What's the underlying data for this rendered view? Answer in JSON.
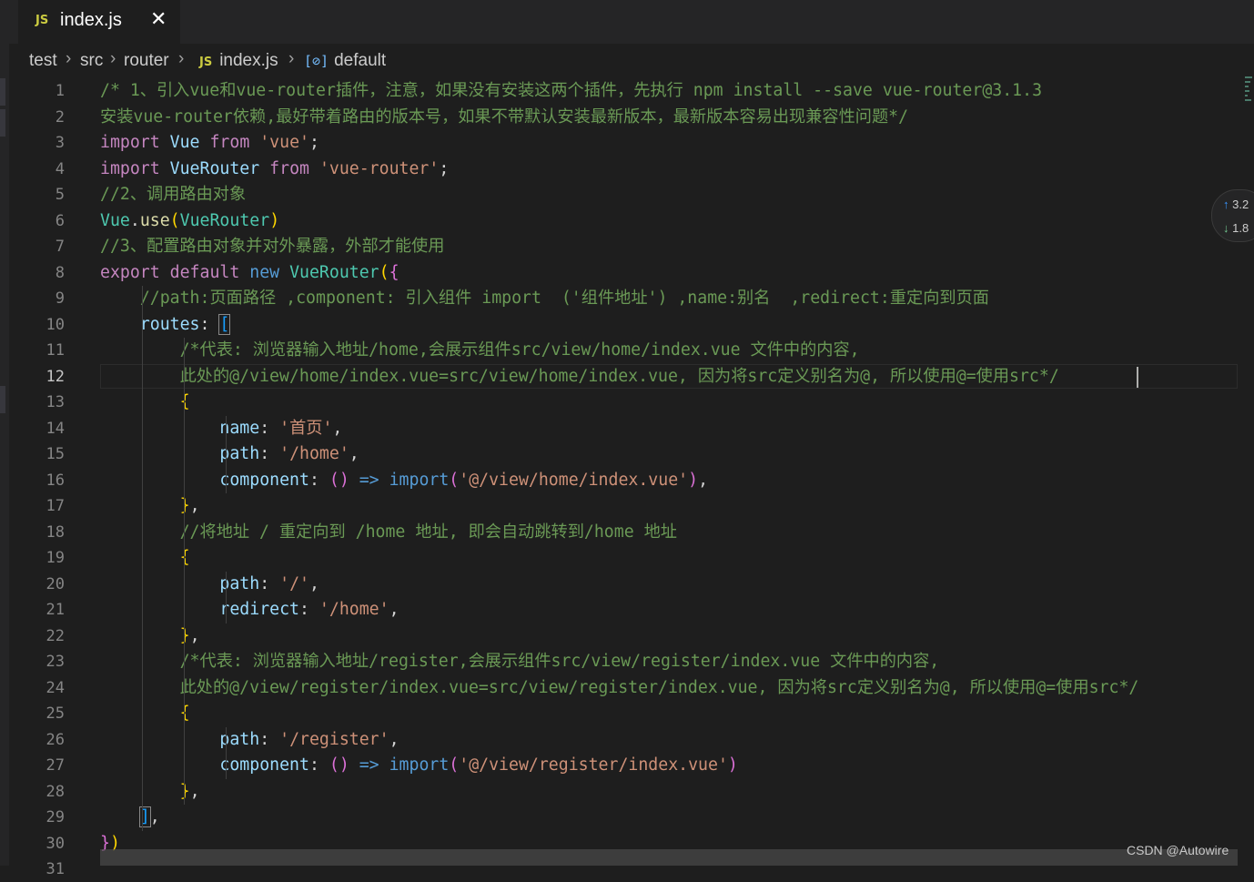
{
  "tab": {
    "icon": "JS",
    "title": "index.js",
    "close": "✕"
  },
  "breadcrumb": {
    "items": [
      "test",
      "src",
      "router",
      "index.js",
      "default"
    ],
    "separator": "›",
    "file_icon": "JS",
    "symbol_icon": "[⊘]"
  },
  "editor": {
    "active_line": 12,
    "lines": [
      {
        "n": "1",
        "code": "/* 1、引入vue和vue-router插件，注意，如果没有安装这两个插件，先执行 npm install --save vue-router@3.1.3"
      },
      {
        "n": "2",
        "code": "安装vue-router依赖,最好带着路由的版本号，如果不带默认安装最新版本，最新版本容易出现兼容性问题*/"
      },
      {
        "n": "3",
        "code": "import Vue from 'vue';"
      },
      {
        "n": "4",
        "code": "import VueRouter from 'vue-router';"
      },
      {
        "n": "5",
        "code": "//2、调用路由对象"
      },
      {
        "n": "6",
        "code": "Vue.use(VueRouter)"
      },
      {
        "n": "7",
        "code": "//3、配置路由对象并对外暴露，外部才能使用"
      },
      {
        "n": "8",
        "code": "export default new VueRouter({"
      },
      {
        "n": "9",
        "code": "    //path:页面路径 ,component: 引入组件 import  ('组件地址') ,name:别名  ,redirect:重定向到页面"
      },
      {
        "n": "10",
        "code": "    routes: ["
      },
      {
        "n": "11",
        "code": "        /*代表: 浏览器输入地址/home,会展示组件src/view/home/index.vue 文件中的内容,"
      },
      {
        "n": "12",
        "code": "        此处的@/view/home/index.vue=src/view/home/index.vue, 因为将src定义别名为@, 所以使用@=使用src*/"
      },
      {
        "n": "13",
        "code": "        {"
      },
      {
        "n": "14",
        "code": "            name: '首页',"
      },
      {
        "n": "15",
        "code": "            path: '/home',"
      },
      {
        "n": "16",
        "code": "            component: () => import('@/view/home/index.vue'),"
      },
      {
        "n": "17",
        "code": "        },"
      },
      {
        "n": "18",
        "code": "        //将地址 / 重定向到 /home 地址, 即会自动跳转到/home 地址"
      },
      {
        "n": "19",
        "code": "        {"
      },
      {
        "n": "20",
        "code": "            path: '/',"
      },
      {
        "n": "21",
        "code": "            redirect: '/home',"
      },
      {
        "n": "22",
        "code": "        },"
      },
      {
        "n": "23",
        "code": "        /*代表: 浏览器输入地址/register,会展示组件src/view/register/index.vue 文件中的内容,"
      },
      {
        "n": "24",
        "code": "        此处的@/view/register/index.vue=src/view/register/index.vue, 因为将src定义别名为@, 所以使用@=使用src*/"
      },
      {
        "n": "25",
        "code": "        {"
      },
      {
        "n": "26",
        "code": "            path: '/register',"
      },
      {
        "n": "27",
        "code": "            component: () => import('@/view/register/index.vue')"
      },
      {
        "n": "28",
        "code": "        },"
      },
      {
        "n": "29",
        "code": "    ],"
      },
      {
        "n": "30",
        "code": "})"
      },
      {
        "n": "31",
        "code": ""
      }
    ]
  },
  "blame": {
    "up": "↑",
    "up_value": "3.2",
    "down": "↓",
    "down_value": "1.8"
  },
  "watermark": "CSDN @Autowire"
}
